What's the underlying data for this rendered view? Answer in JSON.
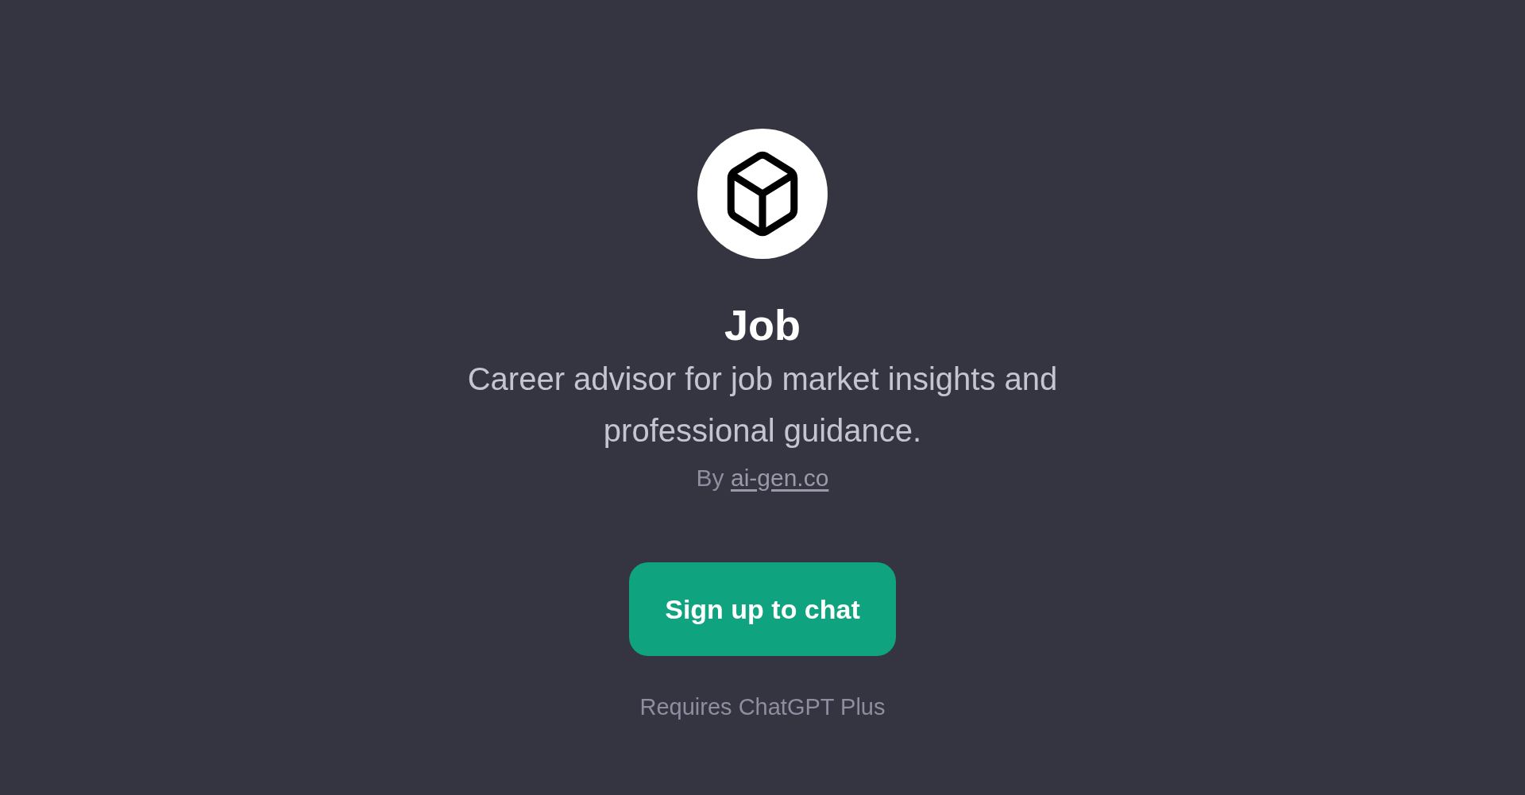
{
  "profile": {
    "title": "Job",
    "description": "Career advisor for job market insights and professional guidance.",
    "author": {
      "prefix": "By",
      "link": "ai-gen.co"
    }
  },
  "actions": {
    "button": "Sign up to chat",
    "note": "Requires ChatGPT Plus"
  }
}
